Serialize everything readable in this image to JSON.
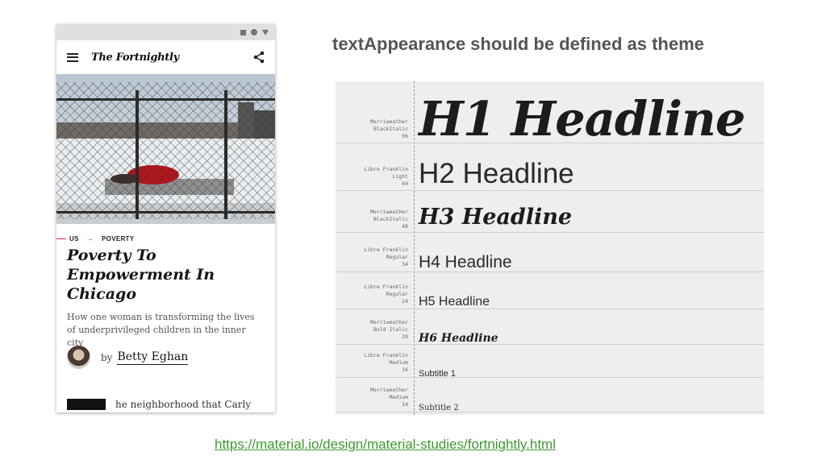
{
  "slide": {
    "title": "textAppearance should be defined as theme",
    "link": "https://material.io/design/material-studies/fortnightly.html"
  },
  "phone": {
    "app_logo": "The Fortnightly",
    "category": {
      "primary": "US",
      "secondary": "POVERTY"
    },
    "article": {
      "title": "Poverty To Empowerment In Chicago",
      "subtitle": "How one woman is transforming the lives of underprivileged children in the inner city",
      "by_label": "by",
      "author": "Betty Eghan",
      "body_start": "he neighborhood that Carly"
    },
    "icons": {
      "menu": "menu-icon",
      "share": "share-icon"
    }
  },
  "type_scale": [
    {
      "spec_font": "Merriweather",
      "spec_weight": "BlackItalic",
      "spec_size": "96",
      "sample": "H1 Headline"
    },
    {
      "spec_font": "Libre Franklin",
      "spec_weight": "Light",
      "spec_size": "60",
      "sample": "H2 Headline"
    },
    {
      "spec_font": "Merriweather",
      "spec_weight": "BlackItalic",
      "spec_size": "48",
      "sample": "H3 Headline"
    },
    {
      "spec_font": "Libre Franklin",
      "spec_weight": "Regular",
      "spec_size": "34",
      "sample": "H4 Headline"
    },
    {
      "spec_font": "Libre Franklin",
      "spec_weight": "Regular",
      "spec_size": "24",
      "sample": "H5 Headline"
    },
    {
      "spec_font": "Merriweather",
      "spec_weight": "Bold Italic",
      "spec_size": "20",
      "sample": "H6 Headline"
    },
    {
      "spec_font": "Libre Franklin",
      "spec_weight": "Medium",
      "spec_size": "16",
      "sample": "Subtitle 1"
    },
    {
      "spec_font": "Merriweather",
      "spec_weight": "Medium",
      "spec_size": "14",
      "sample": "Subtitle 2"
    }
  ],
  "colors": {
    "accent": "#e91e63",
    "link": "#3c9a2e",
    "heading": "#555555"
  }
}
